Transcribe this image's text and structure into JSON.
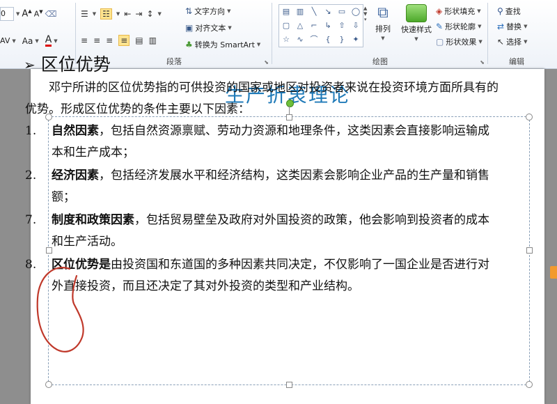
{
  "ribbon": {
    "font_size_value": "0",
    "grow_font": "A",
    "shrink_font": "A",
    "char_spacing": "AV",
    "change_case": "Aa",
    "font_color": "A",
    "text_direction": "文字方向",
    "align_text": "对齐文本",
    "convert_smartart": "转换为 SmartArt",
    "paragraph_group": "段落",
    "arrange": "排列",
    "quick_styles": "快速样式",
    "shape_fill": "形状填充",
    "shape_outline": "形状轮廓",
    "shape_effects": "形状效果",
    "drawing_group": "绘图",
    "find": "查找",
    "replace": "替换",
    "select": "选择",
    "editing_group": "编辑"
  },
  "slide": {
    "title": "生产折衷理论",
    "heading_bullet": "➢",
    "heading": "区位优势",
    "intro": "邓宁所讲的区位优势指的可供投资的国家或地区对投资者来说在投资环境方面所具有的优势。形成区位优势的条件主要以下因素：",
    "items": [
      {
        "num": "1.",
        "bold": "自然因素",
        "text": "，包括自然资源禀赋、劳动力资源和地理条件，这类因素会直接影响运输成本和生产成本；"
      },
      {
        "num": "2.",
        "bold": "经济因素",
        "text": "，包括经济发展水平和经济结构，这类因素会影响企业产品的生产量和销售额；"
      },
      {
        "num": "7.",
        "bold": "制度和政策因素",
        "text": "，包括贸易壁垒及政府对外国投资的政策，他会影响到投资者的成本和生产活动。"
      },
      {
        "num": "8.",
        "bold": "区位优势是",
        "text": "由投资国和东道国的多种因素共同决定，不仅影响了一国企业是否进行对外直接投资，而且还决定了其对外投资的类型和产业结构。"
      }
    ]
  },
  "colors": {
    "title": "#1f7ab8",
    "annotation": "#c0392b"
  }
}
